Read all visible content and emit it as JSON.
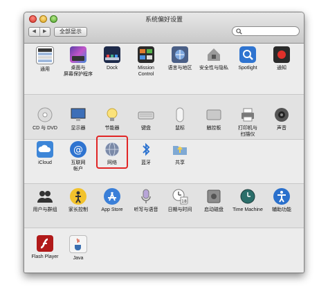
{
  "window": {
    "title": "系统偏好设置"
  },
  "toolbar": {
    "back": "◀",
    "forward": "▶",
    "show_all": "全部显示",
    "search_value": ""
  },
  "sections": [
    {
      "items": [
        {
          "name": "general",
          "label": "通用",
          "icon": "general-icon"
        },
        {
          "name": "desktop",
          "label": "桌面与\n屏幕保护程序",
          "icon": "desktop-icon"
        },
        {
          "name": "dock",
          "label": "Dock",
          "icon": "dock-icon"
        },
        {
          "name": "mission-control",
          "label": "Mission\nControl",
          "icon": "mission-control-icon"
        },
        {
          "name": "language",
          "label": "语言与地区",
          "icon": "flag-icon"
        },
        {
          "name": "security",
          "label": "安全性与隐私",
          "icon": "house-lock-icon"
        },
        {
          "name": "spotlight",
          "label": "Spotlight",
          "icon": "magnifier-icon"
        },
        {
          "name": "notifications",
          "label": "通知",
          "icon": "notification-icon"
        }
      ]
    },
    {
      "items": [
        {
          "name": "cd-dvd",
          "label": "CD 与 DVD",
          "icon": "disc-icon"
        },
        {
          "name": "displays",
          "label": "显示器",
          "icon": "monitor-icon"
        },
        {
          "name": "energy",
          "label": "节能器",
          "icon": "lightbulb-icon"
        },
        {
          "name": "keyboard",
          "label": "键盘",
          "icon": "keyboard-icon"
        },
        {
          "name": "mouse",
          "label": "鼠标",
          "icon": "mouse-icon"
        },
        {
          "name": "trackpad",
          "label": "触控板",
          "icon": "trackpad-icon"
        },
        {
          "name": "printers",
          "label": "打印机与\n扫描仪",
          "icon": "printer-icon"
        },
        {
          "name": "sound",
          "label": "声音",
          "icon": "speaker-icon"
        }
      ]
    },
    {
      "items": [
        {
          "name": "icloud",
          "label": "iCloud",
          "icon": "cloud-icon"
        },
        {
          "name": "internet-accounts",
          "label": "互联网\n帐户",
          "icon": "at-icon"
        },
        {
          "name": "network",
          "label": "网络",
          "icon": "globe-icon"
        },
        {
          "name": "bluetooth",
          "label": "蓝牙",
          "icon": "bluetooth-icon"
        },
        {
          "name": "sharing",
          "label": "共享",
          "icon": "sharing-folder-icon"
        }
      ]
    },
    {
      "items": [
        {
          "name": "users",
          "label": "用户与群组",
          "icon": "users-icon"
        },
        {
          "name": "parental",
          "label": "家长控制",
          "icon": "parental-controls-icon"
        },
        {
          "name": "app-store",
          "label": "App Store",
          "icon": "app-store-icon"
        },
        {
          "name": "dictation",
          "label": "听写与语音",
          "icon": "microphone-icon"
        },
        {
          "name": "date-time",
          "label": "日期与时间",
          "icon": "clock-calendar-icon"
        },
        {
          "name": "startup-disk",
          "label": "启动磁盘",
          "icon": "startup-disk-icon"
        },
        {
          "name": "time-machine",
          "label": "Time Machine",
          "icon": "time-machine-icon"
        },
        {
          "name": "accessibility",
          "label": "辅助功能",
          "icon": "accessibility-icon"
        }
      ]
    },
    {
      "items": [
        {
          "name": "flash-player",
          "label": "Flash Player",
          "icon": "flash-icon"
        },
        {
          "name": "java",
          "label": "Java",
          "icon": "java-cup-icon"
        }
      ]
    }
  ]
}
